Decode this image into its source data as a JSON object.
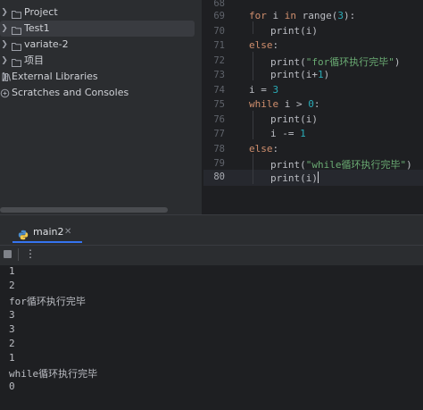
{
  "project_tree": {
    "items": [
      {
        "label": "Project",
        "icon": "folder-icon",
        "expandable": true
      },
      {
        "label": "Test1",
        "icon": "folder-icon",
        "expandable": true,
        "selected": true
      },
      {
        "label": "variate-2",
        "icon": "folder-icon",
        "expandable": true
      },
      {
        "label": "项目",
        "icon": "folder-icon",
        "expandable": true
      },
      {
        "label": "External Libraries",
        "icon": "library-icon",
        "expandable": true
      },
      {
        "label": "Scratches and Consoles",
        "icon": "scratches-icon",
        "expandable": false
      }
    ]
  },
  "editor": {
    "line_numbers": [
      "68",
      "69",
      "70",
      "71",
      "72",
      "73",
      "74",
      "75",
      "76",
      "77",
      "78",
      "79",
      "80"
    ],
    "current_line": "80",
    "code": {
      "l69": {
        "kw": "for",
        "a": " i ",
        "kw2": "in",
        "b": " range(",
        "num": "3",
        "c": "):"
      },
      "l70": {
        "a": "print(i)"
      },
      "l71": {
        "kw": "else",
        "a": ":"
      },
      "l72": {
        "a": "print(",
        "str": "\"for循环执行完毕\"",
        "b": ")"
      },
      "l73": {
        "a": "print(i+",
        "num": "1",
        "b": ")"
      },
      "l74": {
        "a": "i = ",
        "num": "3"
      },
      "l75": {
        "kw": "while",
        "a": " i > ",
        "num": "0",
        "b": ":"
      },
      "l76": {
        "a": "print(i)"
      },
      "l77": {
        "a": "i -= ",
        "num": "1"
      },
      "l78": {
        "kw": "else",
        "a": ":"
      },
      "l79": {
        "a": "print(",
        "str": "\"while循环执行完毕\"",
        "b": ")"
      },
      "l80": {
        "a": "print(i)"
      }
    }
  },
  "run_panel": {
    "tab_label": "main2",
    "tab_icon": "python-icon",
    "close_icon": "close-icon",
    "output_lines": [
      "1",
      "2",
      "for循环执行完毕",
      "3",
      "3",
      "2",
      "1",
      "while循环执行完毕",
      "0"
    ]
  },
  "colors": {
    "keyword": "#cf8e6d",
    "number": "#2aacb8",
    "string": "#6aab73",
    "accent": "#3574f0"
  }
}
